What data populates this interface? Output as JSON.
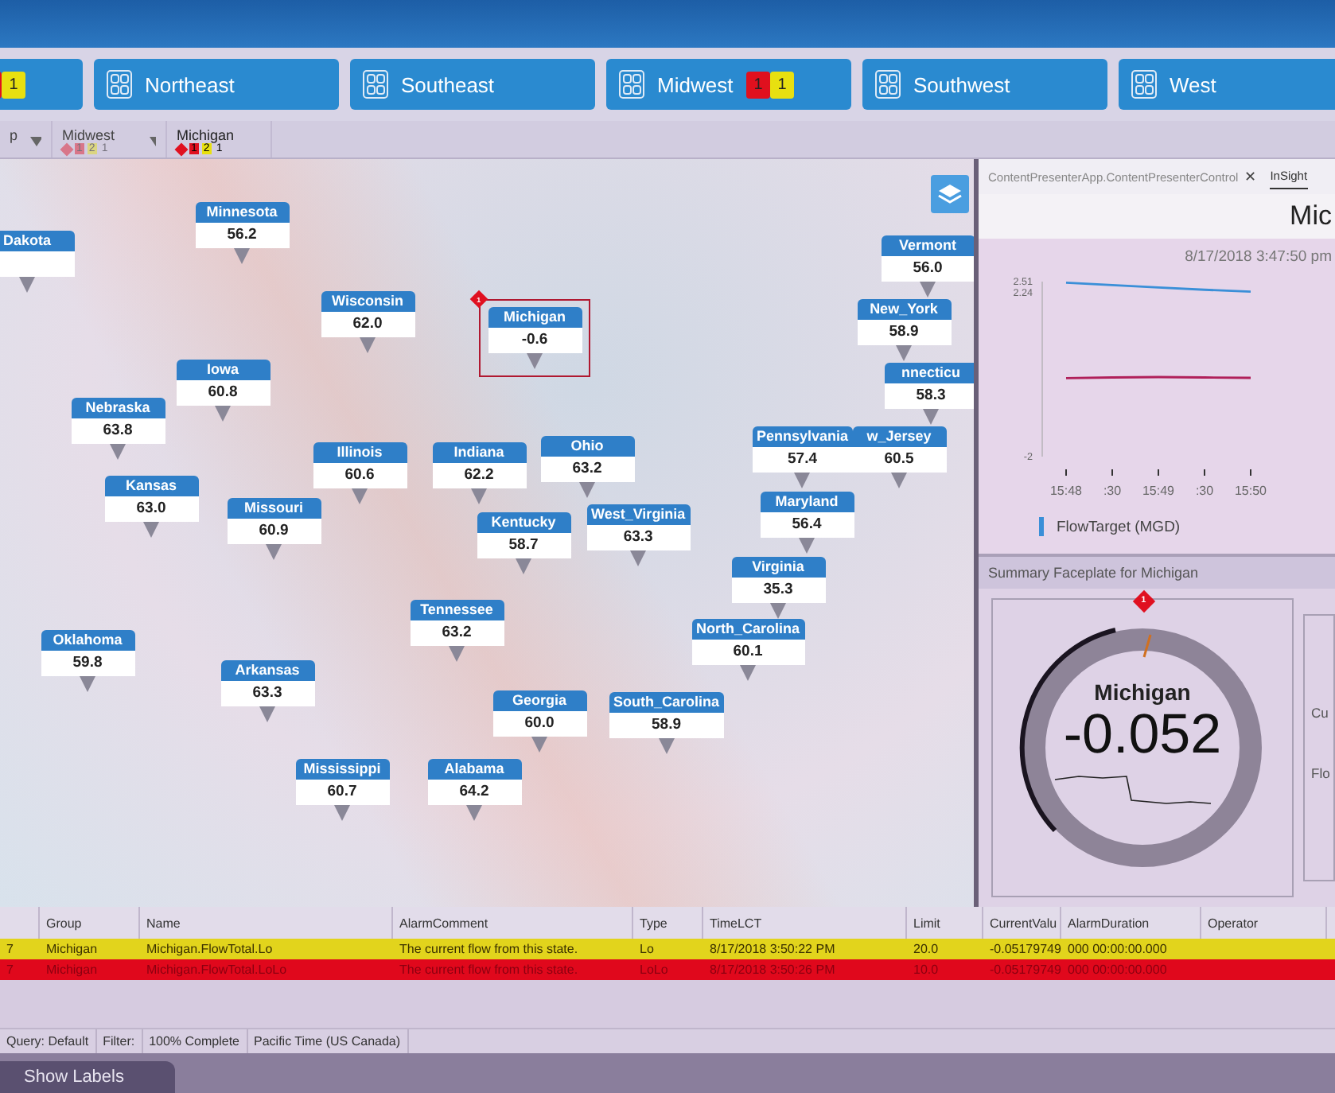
{
  "region_tiles": [
    {
      "badges": [
        {
          "color": "#e0101e"
        },
        {
          "text": "1",
          "color": "#e8e010"
        }
      ]
    },
    {
      "label": "Northeast"
    },
    {
      "label": "Southeast"
    },
    {
      "label": "Midwest",
      "badges": [
        {
          "text": "1",
          "color": "#e0101e"
        },
        {
          "text": "1",
          "color": "#e8e010"
        }
      ]
    },
    {
      "label": "Southwest"
    },
    {
      "label": "West"
    }
  ],
  "breadcrumb": [
    {
      "label": "p",
      "selected": false
    },
    {
      "label": "Midwest",
      "selected": false,
      "counts": [
        "1",
        "2",
        "1"
      ]
    },
    {
      "label": "Michigan",
      "selected": true,
      "counts": [
        "1",
        "2",
        "1"
      ]
    }
  ],
  "map_markers": [
    {
      "name": "Dakota",
      "selected": false
    },
    {
      "name": "Minnesota",
      "value": "56.2",
      "selected": false
    },
    {
      "name": "Vermont",
      "value": "56.0",
      "selected": false
    },
    {
      "name": "Wisconsin",
      "value": "62.0",
      "selected": false
    },
    {
      "name": "Michigan",
      "value": "-0.6",
      "selected": true,
      "alarm": "1"
    },
    {
      "name": "New_York",
      "value": "58.9",
      "selected": false
    },
    {
      "name": "Iowa",
      "value": "60.8",
      "selected": false
    },
    {
      "name": "nnecticu",
      "value": "58.3",
      "selected": false
    },
    {
      "name": "Nebraska",
      "value": "63.8",
      "selected": false
    },
    {
      "name": "Illinois",
      "value": "60.6",
      "selected": false
    },
    {
      "name": "Indiana",
      "value": "62.2",
      "selected": false
    },
    {
      "name": "Ohio",
      "value": "63.2",
      "selected": false
    },
    {
      "name": "Pennsylvania",
      "value": "57.4",
      "selected": false
    },
    {
      "name": "w_Jersey",
      "value": "60.5",
      "selected": false
    },
    {
      "name": "Kansas",
      "value": "63.0",
      "selected": false
    },
    {
      "name": "Missouri",
      "value": "60.9",
      "selected": false
    },
    {
      "name": "Kentucky",
      "value": "58.7",
      "selected": false
    },
    {
      "name": "West_Virginia",
      "value": "63.3",
      "selected": false
    },
    {
      "name": "Maryland",
      "value": "56.4",
      "selected": false
    },
    {
      "name": "Virginia",
      "value": "35.3",
      "selected": false
    },
    {
      "name": "Tennessee",
      "value": "63.2",
      "selected": false
    },
    {
      "name": "Oklahoma",
      "value": "59.8",
      "selected": false
    },
    {
      "name": "North_Carolina",
      "value": "60.1",
      "selected": false
    },
    {
      "name": "Arkansas",
      "value": "63.3",
      "selected": false
    },
    {
      "name": "Georgia",
      "value": "60.0",
      "selected": false
    },
    {
      "name": "South_Carolina",
      "value": "58.9",
      "selected": false
    },
    {
      "name": "Mississippi",
      "value": "60.7",
      "selected": false
    },
    {
      "name": "Alabama",
      "value": "64.2",
      "selected": false
    }
  ],
  "trend_panel": {
    "tabs": [
      {
        "label": "ContentPresenterApp.ContentPresenterControl",
        "selected": false,
        "close": "✕"
      },
      {
        "label": "InSight",
        "selected": true
      }
    ],
    "title": "Mic",
    "timestamp": "8/17/2018 3:47:50 pm",
    "chart_data": {
      "type": "line",
      "categories": [
        "15:48",
        ":30",
        "15:49",
        ":30",
        "15:50"
      ],
      "ylim": [
        -2,
        2.51
      ],
      "yticks": [
        -2,
        2.24,
        2.51
      ],
      "series": [
        {
          "name": "FlowTarget (MGD)",
          "color": "#3a8fd8",
          "values": [
            2.48,
            2.42,
            2.36,
            2.3,
            2.25
          ]
        },
        {
          "color": "#b0205a",
          "values": [
            0.02,
            0.04,
            0.05,
            0.04,
            0.03
          ]
        }
      ]
    }
  },
  "faceplate": {
    "header": "Summary Faceplate for  Michigan",
    "name": "Michigan",
    "value": "-0.052",
    "alarm": "1",
    "side_labels": [
      "Cu",
      "Flo"
    ]
  },
  "alarm_table": {
    "columns": [
      "",
      "Group",
      "Name",
      "AlarmComment",
      "Type",
      "TimeLCT",
      "Limit",
      "CurrentValu",
      "AlarmDuration",
      "Operator"
    ],
    "rows": [
      {
        "kind": "warning",
        "cells": [
          "7",
          "Michigan",
          "Michigan.FlowTotal.Lo",
          "The current flow from this state.",
          "Lo",
          "8/17/2018 3:50:22 PM",
          "20.0",
          "-0.05179749",
          "000 00:00:00.000",
          ""
        ]
      },
      {
        "kind": "critical",
        "cells": [
          "7",
          "Michigan",
          "Michigan.FlowTotal.LoLo",
          "The current flow from this state.",
          "LoLo",
          "8/17/2018 3:50:26 PM",
          "10.0",
          "-0.05179749",
          "000 00:00:00.000",
          ""
        ]
      }
    ]
  },
  "status_bar": [
    "Query: Default",
    "Filter:",
    "100% Complete",
    "Pacific Time (US  Canada)"
  ],
  "show_labels_button": "Show Labels"
}
